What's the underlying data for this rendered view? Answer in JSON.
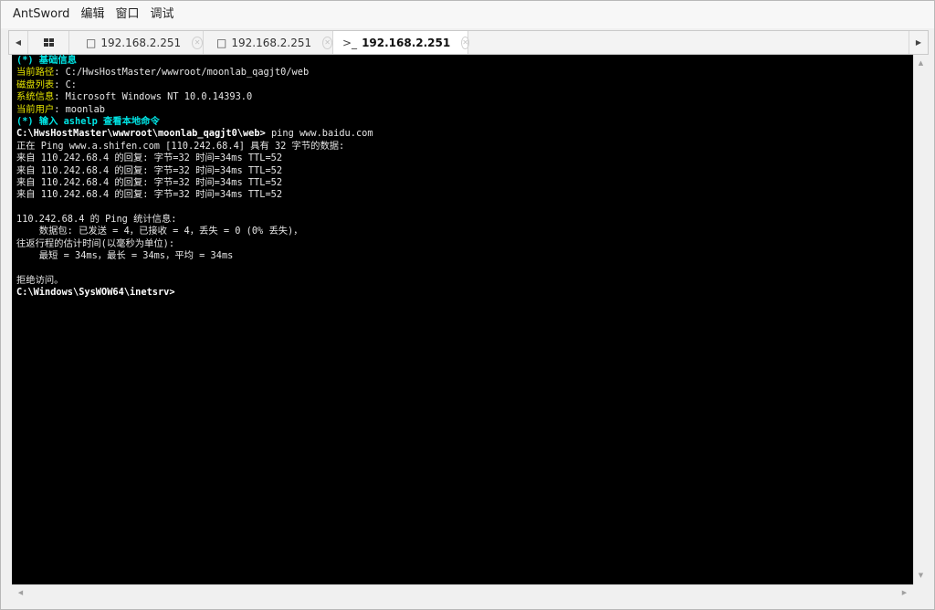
{
  "menubar": {
    "app_name": "AntSword",
    "items": [
      "编辑",
      "窗口",
      "调试"
    ]
  },
  "tabs": {
    "scroll_left": "◀",
    "scroll_right": "▶",
    "home_icon": "grid-icon",
    "items": [
      {
        "label": "192.168.2.251",
        "icon": "□",
        "close": "✕"
      },
      {
        "label": "192.168.2.251",
        "icon": "□",
        "close": "✕"
      },
      {
        "label": "192.168.2.251",
        "icon": ">_",
        "close": "✕",
        "active": true
      }
    ]
  },
  "terminal": {
    "lines": [
      [
        {
          "t": "(*) 基础信息",
          "c": "cyan"
        }
      ],
      [
        {
          "t": "当前路径",
          "c": "yellow"
        },
        {
          "t": ": C:/HwsHostMaster/wwwroot/moonlab_qagjt0/web",
          "c": "white"
        }
      ],
      [
        {
          "t": "磁盘列表",
          "c": "yellow"
        },
        {
          "t": ": C:",
          "c": "white"
        }
      ],
      [
        {
          "t": "系统信息",
          "c": "yellow"
        },
        {
          "t": ": Microsoft Windows NT 10.0.14393.0",
          "c": "white"
        }
      ],
      [
        {
          "t": "当前用户",
          "c": "yellow"
        },
        {
          "t": ": moonlab",
          "c": "white"
        }
      ],
      [
        {
          "t": "(*) 输入 ashelp 查看本地命令",
          "c": "cyan"
        }
      ],
      [
        {
          "t": "C:\\HwsHostMaster\\wwwroot\\moonlab_qagjt0\\web> ",
          "c": "bold"
        },
        {
          "t": "ping www.baidu.com",
          "c": "white"
        }
      ],
      [
        {
          "t": "正在 Ping www.a.shifen.com [110.242.68.4] 具有 32 字节的数据:",
          "c": "white"
        }
      ],
      [
        {
          "t": "来自 110.242.68.4 的回复: 字节=32 时间=34ms TTL=52",
          "c": "white"
        }
      ],
      [
        {
          "t": "来自 110.242.68.4 的回复: 字节=32 时间=34ms TTL=52",
          "c": "white"
        }
      ],
      [
        {
          "t": "来自 110.242.68.4 的回复: 字节=32 时间=34ms TTL=52",
          "c": "white"
        }
      ],
      [
        {
          "t": "来自 110.242.68.4 的回复: 字节=32 时间=34ms TTL=52",
          "c": "white"
        }
      ],
      [
        {
          "t": "",
          "c": "white"
        }
      ],
      [
        {
          "t": "110.242.68.4 的 Ping 统计信息:",
          "c": "white"
        }
      ],
      [
        {
          "t": "    数据包: 已发送 = 4，已接收 = 4，丢失 = 0 (0% 丢失)，",
          "c": "white"
        }
      ],
      [
        {
          "t": "往返行程的估计时间(以毫秒为单位):",
          "c": "white"
        }
      ],
      [
        {
          "t": "    最短 = 34ms，最长 = 34ms，平均 = 34ms",
          "c": "white"
        }
      ],
      [
        {
          "t": "",
          "c": "white"
        }
      ],
      [
        {
          "t": "拒绝访问。",
          "c": "white"
        }
      ],
      [
        {
          "t": "C:\\Windows\\SysWOW64\\inetsrv>",
          "c": "bold"
        }
      ]
    ]
  },
  "scrollbar": {
    "up": "▲",
    "down": "▼",
    "left": "◀",
    "right": "▶"
  }
}
